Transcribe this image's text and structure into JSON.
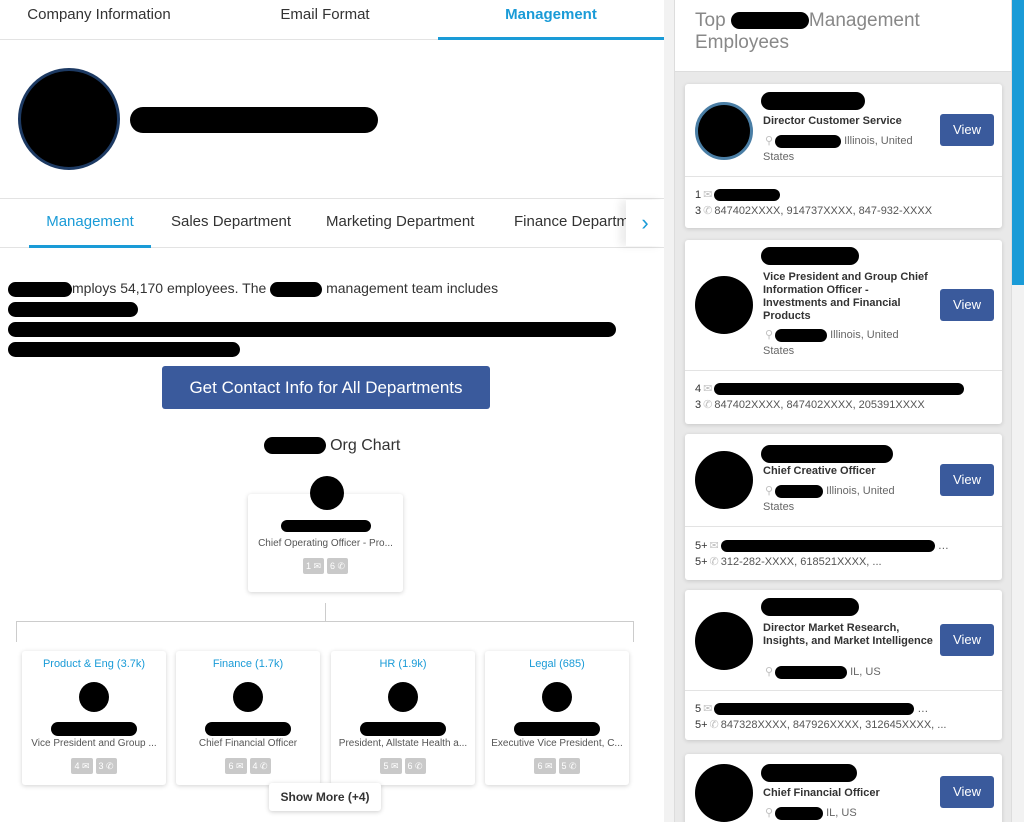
{
  "top_tabs": [
    "Company Information",
    "Email Format",
    "Management"
  ],
  "dept_tabs": [
    "Management",
    "Sales Department",
    "Marketing Department",
    "Finance Departm"
  ],
  "summary": {
    "part1": "mploys 54,170 employees. The",
    "part2": "management team includes"
  },
  "cta_label": "Get Contact Info for All Departments",
  "org_chart": {
    "title_suffix": "Org Chart",
    "top": {
      "title": "Chief Operating Officer - Pro...",
      "emails": "1",
      "phones": "6"
    },
    "departments": [
      {
        "name": "Product & Eng (3.7k)",
        "title": "Vice President and Group ...",
        "emails": "4",
        "phones": "3"
      },
      {
        "name": "Finance (1.7k)",
        "title": "Chief Financial Officer",
        "emails": "6",
        "phones": "4"
      },
      {
        "name": "HR (1.9k)",
        "title": "President, Allstate Health a...",
        "emails": "5",
        "phones": "6"
      },
      {
        "name": "Legal (685)",
        "title": "Executive Vice President, C...",
        "emails": "6",
        "phones": "5"
      }
    ],
    "show_more": "Show More (+4)"
  },
  "right_panel": {
    "heading_top": "Top",
    "heading_bottom": "Management",
    "heading_line2": "Employees",
    "view_label": "View",
    "employees": [
      {
        "title": "Director Customer Service",
        "location": "Illinois, United",
        "location2": "States",
        "email_count": "1",
        "phone_count": "3",
        "phones": "847402XXXX,  914737XXXX,  847-932-XXXX"
      },
      {
        "title": "Vice President and Group Chief Information Officer - Investments and Financial Products",
        "location": "Illinois, United",
        "location2": "States",
        "email_count": "4",
        "phone_count": "3",
        "phones": "847402XXXX,  847402XXXX,  205391XXXX"
      },
      {
        "title": "Chief Creative Officer",
        "location": "Illinois, United",
        "location2": "States",
        "email_count": "5+",
        "phone_count": "5+",
        "phones": "312-282-XXXX,  618521XXXX,  ..."
      },
      {
        "title": "Director Market Research, Insights, and Market Intelligence",
        "location": "IL, US",
        "location2": "",
        "email_count": "5",
        "phone_count": "5+",
        "phones": "847328XXXX,  847926XXXX,  312645XXXX, ..."
      },
      {
        "title": "Chief Financial Officer",
        "location": "IL, US",
        "location2": "",
        "email_count": "",
        "phone_count": "",
        "phones": ""
      }
    ]
  }
}
